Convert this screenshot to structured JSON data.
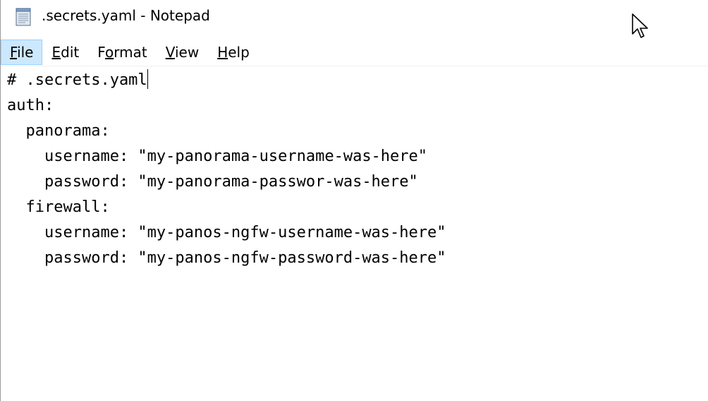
{
  "window": {
    "title": ".secrets.yaml - Notepad",
    "icon": "notepad-icon"
  },
  "menubar": {
    "items": [
      {
        "mnemonic": "F",
        "rest": "ile",
        "active": true
      },
      {
        "mnemonic": "E",
        "rest": "dit",
        "active": false
      },
      {
        "pre": "F",
        "mnemonic": "o",
        "rest": "rmat",
        "active": false
      },
      {
        "mnemonic": "V",
        "rest": "iew",
        "active": false
      },
      {
        "mnemonic": "H",
        "rest": "elp",
        "active": false
      }
    ]
  },
  "editor": {
    "lines": [
      "# .secrets.yaml",
      "auth:",
      "  panorama:",
      "    username: \"my-panorama-username-was-here\"",
      "    password: \"my-panorama-passwor-was-here\"",
      "  firewall:",
      "    username: \"my-panos-ngfw-username-was-here\"",
      "    password: \"my-panos-ngfw-password-was-here\""
    ],
    "caret_line": 0
  },
  "icons": {
    "cursor": "mouse-pointer-icon"
  }
}
